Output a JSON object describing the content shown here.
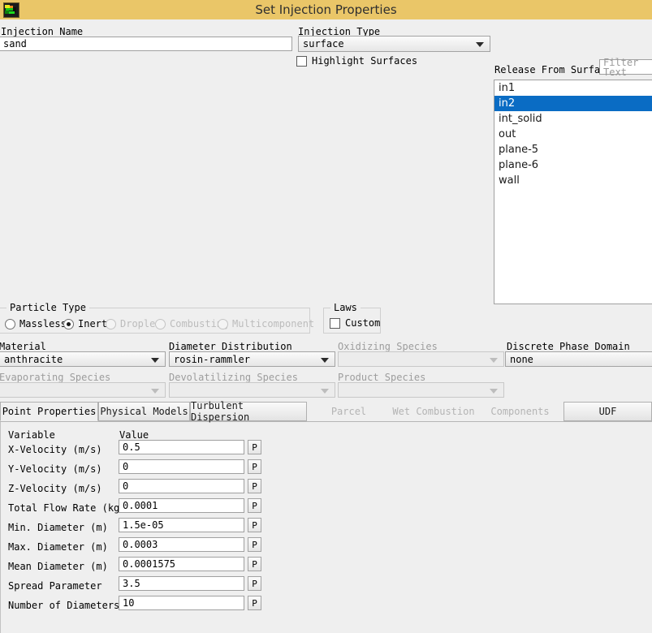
{
  "window": {
    "title": "Set Injection Properties",
    "icon": "fluent-app-icon",
    "titlebar_color": "#eac668",
    "selection_color": "#0a6cc4"
  },
  "injection": {
    "name_label": "Injection Name",
    "name_value": "sand",
    "type_label": "Injection Type",
    "type_value": "surface",
    "highlight_surfaces_label": "Highlight Surfaces",
    "highlight_surfaces_checked": false
  },
  "release": {
    "label": "Release From Surfaces",
    "filter_placeholder": "Filter Text",
    "filter_value": "",
    "items": [
      {
        "label": "in1",
        "selected": false
      },
      {
        "label": "in2",
        "selected": true
      },
      {
        "label": "int_solid",
        "selected": false
      },
      {
        "label": "out",
        "selected": false
      },
      {
        "label": "plane-5",
        "selected": false
      },
      {
        "label": "plane-6",
        "selected": false
      },
      {
        "label": "wall",
        "selected": false
      }
    ]
  },
  "particle_type": {
    "title": "Particle Type",
    "options": [
      {
        "label": "Massless",
        "selected": false,
        "disabled": false
      },
      {
        "label": "Inert",
        "selected": true,
        "disabled": false
      },
      {
        "label": "Droplet",
        "selected": false,
        "disabled": true
      },
      {
        "label": "Combusting",
        "selected": false,
        "disabled": true
      },
      {
        "label": "Multicomponent",
        "selected": false,
        "disabled": true
      }
    ]
  },
  "laws": {
    "title": "Laws",
    "custom_label": "Custom",
    "custom_checked": false
  },
  "properties": {
    "material_label": "Material",
    "material_value": "anthracite",
    "diameter_distribution_label": "Diameter Distribution",
    "diameter_distribution_value": "rosin-rammler",
    "oxidizing_species_label": "Oxidizing Species",
    "oxidizing_species_value": "",
    "discrete_phase_domain_label": "Discrete Phase Domain",
    "discrete_phase_domain_value": "none",
    "evaporating_species_label": "Evaporating Species",
    "evaporating_species_value": "",
    "devolatilizing_species_label": "Devolatilizing Species",
    "devolatilizing_species_value": "",
    "product_species_label": "Product Species",
    "product_species_value": ""
  },
  "tabs": [
    {
      "label": "Point Properties",
      "active": true,
      "disabled": false
    },
    {
      "label": "Physical Models",
      "active": false,
      "disabled": false
    },
    {
      "label": "Turbulent Dispersion",
      "active": false,
      "disabled": false
    },
    {
      "label": "Parcel",
      "active": false,
      "disabled": true
    },
    {
      "label": "Wet Combustion",
      "active": false,
      "disabled": true
    },
    {
      "label": "Components",
      "active": false,
      "disabled": true
    },
    {
      "label": "UDF",
      "active": false,
      "disabled": false
    }
  ],
  "point_properties": {
    "col_variable": "Variable",
    "col_value": "Value",
    "profile_button_label": "P",
    "rows": [
      {
        "variable": "X-Velocity (m/s)",
        "value": "0.5"
      },
      {
        "variable": "Y-Velocity (m/s)",
        "value": "0"
      },
      {
        "variable": "Z-Velocity (m/s)",
        "value": "0"
      },
      {
        "variable": "Total Flow Rate (kg/s)",
        "value": "0.0001"
      },
      {
        "variable": "Min. Diameter (m)",
        "value": "1.5e-05"
      },
      {
        "variable": "Max. Diameter (m)",
        "value": "0.0003"
      },
      {
        "variable": "Mean Diameter (m)",
        "value": "0.0001575"
      },
      {
        "variable": "Spread Parameter",
        "value": "3.5"
      },
      {
        "variable": "Number of Diameters",
        "value": "10"
      }
    ]
  }
}
